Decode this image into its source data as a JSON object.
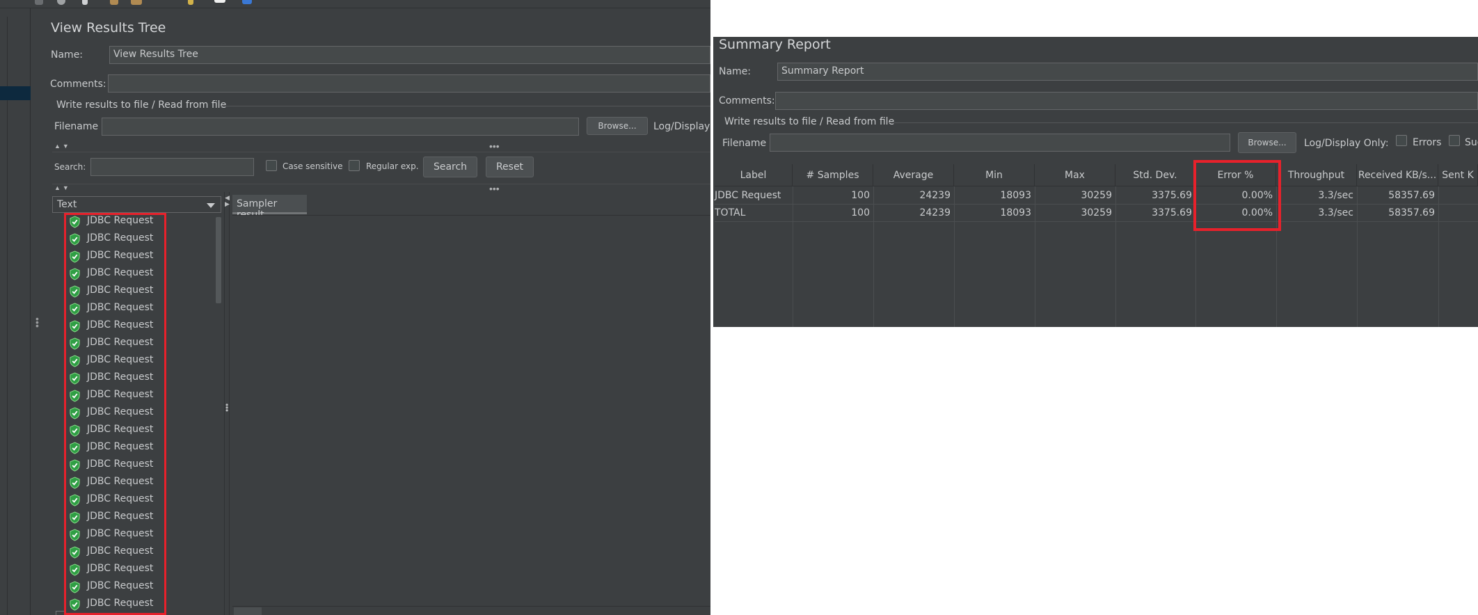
{
  "left": {
    "title": "View Results Tree",
    "name_label": "Name:",
    "name_value": "View Results Tree",
    "comments_label": "Comments:",
    "comments_value": "",
    "file_group_label": "Write results to file / Read from file",
    "filename_label": "Filename",
    "filename_value": "",
    "browse_label": "Browse...",
    "log_display_label": "Log/Display",
    "search_label": "Search:",
    "search_value": "",
    "case_sensitive_label": "Case sensitive",
    "regular_exp_label": "Regular exp.",
    "search_button": "Search",
    "reset_button": "Reset",
    "renderer_selected": "Text",
    "result_tab": "Sampler result",
    "results": [
      "JDBC Request",
      "JDBC Request",
      "JDBC Request",
      "JDBC Request",
      "JDBC Request",
      "JDBC Request",
      "JDBC Request",
      "JDBC Request",
      "JDBC Request",
      "JDBC Request",
      "JDBC Request",
      "JDBC Request",
      "JDBC Request",
      "JDBC Request",
      "JDBC Request",
      "JDBC Request",
      "JDBC Request",
      "JDBC Request",
      "JDBC Request",
      "JDBC Request",
      "JDBC Request",
      "JDBC Request",
      "JDBC Request"
    ],
    "result_status_icon": "success-shield-icon",
    "highlight_color": "#e8212b"
  },
  "right": {
    "title": "Summary Report",
    "name_label": "Name:",
    "name_value": "Summary Report",
    "comments_label": "Comments:",
    "comments_value": "",
    "file_group_label": "Write results to file / Read from file",
    "filename_label": "Filename",
    "filename_value": "",
    "browse_label": "Browse...",
    "log_display_label": "Log/Display Only:",
    "errors_label": "Errors",
    "successes_label": "Suc",
    "table": {
      "headers": [
        "Label",
        "# Samples",
        "Average",
        "Min",
        "Max",
        "Std. Dev.",
        "Error %",
        "Throughput",
        "Received KB/s...",
        "Sent K"
      ],
      "rows": [
        [
          "JDBC Request",
          "100",
          "24239",
          "18093",
          "30259",
          "3375.69",
          "0.00%",
          "3.3/sec",
          "58357.69",
          ""
        ],
        [
          "TOTAL",
          "100",
          "24239",
          "18093",
          "30259",
          "3375.69",
          "0.00%",
          "3.3/sec",
          "58357.69",
          ""
        ]
      ]
    },
    "highlighted_column": "Error %"
  }
}
